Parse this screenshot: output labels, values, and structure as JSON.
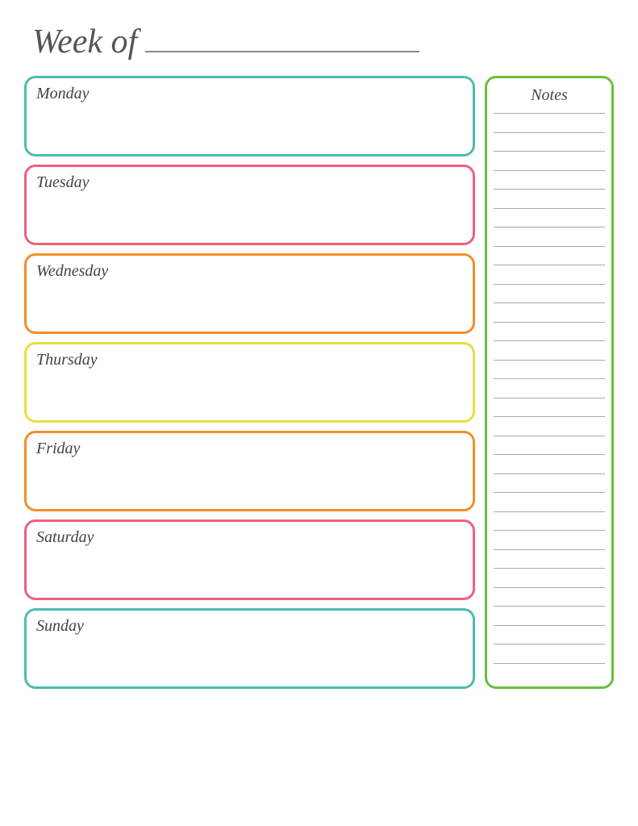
{
  "header": {
    "week_of_label": "Week of",
    "line_placeholder": ""
  },
  "days": [
    {
      "id": "monday",
      "label": "Monday",
      "border_color": "#4bbdad"
    },
    {
      "id": "tuesday",
      "label": "Tuesday",
      "border_color": "#f0607a"
    },
    {
      "id": "wednesday",
      "label": "Wednesday",
      "border_color": "#f0902a"
    },
    {
      "id": "thursday",
      "label": "Thursday",
      "border_color": "#e8e040"
    },
    {
      "id": "friday",
      "label": "Friday",
      "border_color": "#f0902a"
    },
    {
      "id": "saturday",
      "label": "Saturday",
      "border_color": "#f0607a"
    },
    {
      "id": "sunday",
      "label": "Sunday",
      "border_color": "#4bbdad"
    }
  ],
  "notes": {
    "title": "Notes",
    "line_count": 30,
    "border_color": "#6abf3a"
  }
}
